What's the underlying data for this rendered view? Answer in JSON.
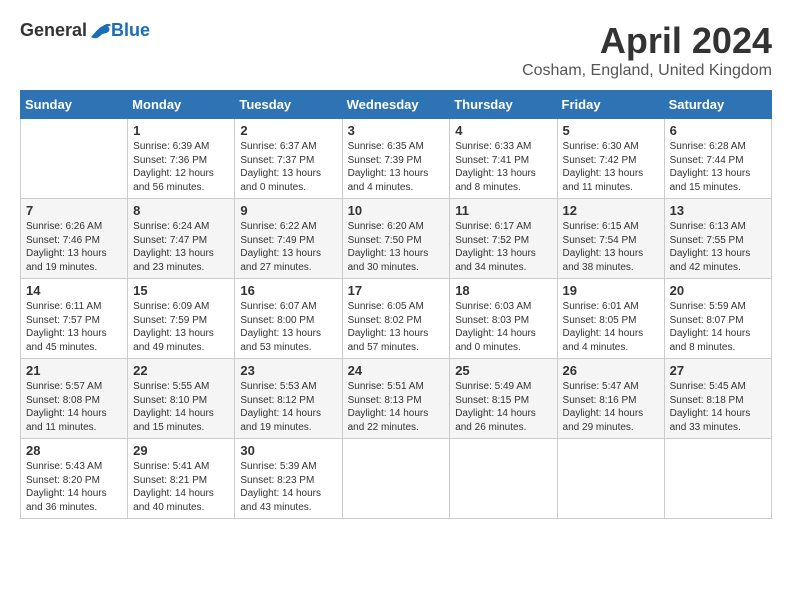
{
  "header": {
    "logo_general": "General",
    "logo_blue": "Blue",
    "month_title": "April 2024",
    "location": "Cosham, England, United Kingdom"
  },
  "days_of_week": [
    "Sunday",
    "Monday",
    "Tuesday",
    "Wednesday",
    "Thursday",
    "Friday",
    "Saturday"
  ],
  "weeks": [
    [
      {
        "date": "",
        "info": ""
      },
      {
        "date": "1",
        "info": "Sunrise: 6:39 AM\nSunset: 7:36 PM\nDaylight: 12 hours\nand 56 minutes."
      },
      {
        "date": "2",
        "info": "Sunrise: 6:37 AM\nSunset: 7:37 PM\nDaylight: 13 hours\nand 0 minutes."
      },
      {
        "date": "3",
        "info": "Sunrise: 6:35 AM\nSunset: 7:39 PM\nDaylight: 13 hours\nand 4 minutes."
      },
      {
        "date": "4",
        "info": "Sunrise: 6:33 AM\nSunset: 7:41 PM\nDaylight: 13 hours\nand 8 minutes."
      },
      {
        "date": "5",
        "info": "Sunrise: 6:30 AM\nSunset: 7:42 PM\nDaylight: 13 hours\nand 11 minutes."
      },
      {
        "date": "6",
        "info": "Sunrise: 6:28 AM\nSunset: 7:44 PM\nDaylight: 13 hours\nand 15 minutes."
      }
    ],
    [
      {
        "date": "7",
        "info": "Sunrise: 6:26 AM\nSunset: 7:46 PM\nDaylight: 13 hours\nand 19 minutes."
      },
      {
        "date": "8",
        "info": "Sunrise: 6:24 AM\nSunset: 7:47 PM\nDaylight: 13 hours\nand 23 minutes."
      },
      {
        "date": "9",
        "info": "Sunrise: 6:22 AM\nSunset: 7:49 PM\nDaylight: 13 hours\nand 27 minutes."
      },
      {
        "date": "10",
        "info": "Sunrise: 6:20 AM\nSunset: 7:50 PM\nDaylight: 13 hours\nand 30 minutes."
      },
      {
        "date": "11",
        "info": "Sunrise: 6:17 AM\nSunset: 7:52 PM\nDaylight: 13 hours\nand 34 minutes."
      },
      {
        "date": "12",
        "info": "Sunrise: 6:15 AM\nSunset: 7:54 PM\nDaylight: 13 hours\nand 38 minutes."
      },
      {
        "date": "13",
        "info": "Sunrise: 6:13 AM\nSunset: 7:55 PM\nDaylight: 13 hours\nand 42 minutes."
      }
    ],
    [
      {
        "date": "14",
        "info": "Sunrise: 6:11 AM\nSunset: 7:57 PM\nDaylight: 13 hours\nand 45 minutes."
      },
      {
        "date": "15",
        "info": "Sunrise: 6:09 AM\nSunset: 7:59 PM\nDaylight: 13 hours\nand 49 minutes."
      },
      {
        "date": "16",
        "info": "Sunrise: 6:07 AM\nSunset: 8:00 PM\nDaylight: 13 hours\nand 53 minutes."
      },
      {
        "date": "17",
        "info": "Sunrise: 6:05 AM\nSunset: 8:02 PM\nDaylight: 13 hours\nand 57 minutes."
      },
      {
        "date": "18",
        "info": "Sunrise: 6:03 AM\nSunset: 8:03 PM\nDaylight: 14 hours\nand 0 minutes."
      },
      {
        "date": "19",
        "info": "Sunrise: 6:01 AM\nSunset: 8:05 PM\nDaylight: 14 hours\nand 4 minutes."
      },
      {
        "date": "20",
        "info": "Sunrise: 5:59 AM\nSunset: 8:07 PM\nDaylight: 14 hours\nand 8 minutes."
      }
    ],
    [
      {
        "date": "21",
        "info": "Sunrise: 5:57 AM\nSunset: 8:08 PM\nDaylight: 14 hours\nand 11 minutes."
      },
      {
        "date": "22",
        "info": "Sunrise: 5:55 AM\nSunset: 8:10 PM\nDaylight: 14 hours\nand 15 minutes."
      },
      {
        "date": "23",
        "info": "Sunrise: 5:53 AM\nSunset: 8:12 PM\nDaylight: 14 hours\nand 19 minutes."
      },
      {
        "date": "24",
        "info": "Sunrise: 5:51 AM\nSunset: 8:13 PM\nDaylight: 14 hours\nand 22 minutes."
      },
      {
        "date": "25",
        "info": "Sunrise: 5:49 AM\nSunset: 8:15 PM\nDaylight: 14 hours\nand 26 minutes."
      },
      {
        "date": "26",
        "info": "Sunrise: 5:47 AM\nSunset: 8:16 PM\nDaylight: 14 hours\nand 29 minutes."
      },
      {
        "date": "27",
        "info": "Sunrise: 5:45 AM\nSunset: 8:18 PM\nDaylight: 14 hours\nand 33 minutes."
      }
    ],
    [
      {
        "date": "28",
        "info": "Sunrise: 5:43 AM\nSunset: 8:20 PM\nDaylight: 14 hours\nand 36 minutes."
      },
      {
        "date": "29",
        "info": "Sunrise: 5:41 AM\nSunset: 8:21 PM\nDaylight: 14 hours\nand 40 minutes."
      },
      {
        "date": "30",
        "info": "Sunrise: 5:39 AM\nSunset: 8:23 PM\nDaylight: 14 hours\nand 43 minutes."
      },
      {
        "date": "",
        "info": ""
      },
      {
        "date": "",
        "info": ""
      },
      {
        "date": "",
        "info": ""
      },
      {
        "date": "",
        "info": ""
      }
    ]
  ]
}
